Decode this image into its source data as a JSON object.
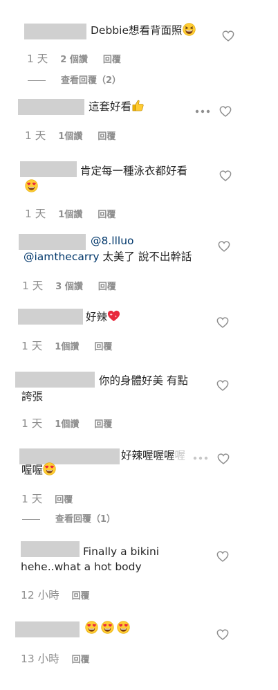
{
  "comments": [
    {
      "text": "Debbie想看背面照",
      "time": "1 天",
      "likes": "2 個讚",
      "reply": "回覆",
      "view_replies": "查看回覆（2）"
    },
    {
      "text": "這套好看",
      "time": "1 天",
      "likes": "1個讚",
      "reply": "回覆"
    },
    {
      "text": "肯定每一種泳衣都好看",
      "time": "1 天",
      "likes": "1個讚",
      "reply": "回覆"
    },
    {
      "mention": "@8.llluo",
      "text_line2_mention": "@iamthecarry",
      "text_line2": " 太美了 說不出幹話",
      "time": "1 天",
      "likes": "3 個讚",
      "reply": "回覆"
    },
    {
      "text": "好辣",
      "time": "1 天",
      "likes": "1個讚",
      "reply": "回覆"
    },
    {
      "text": "你的身體好美 有點",
      "text_line2": "誇張",
      "time": "1 天",
      "likes": "1個讚",
      "reply": "回覆"
    },
    {
      "text": "好辣喔喔喔",
      "text_faded": "喔",
      "text_line2": "喔喔",
      "time": "1 天",
      "reply": "回覆",
      "view_replies": "查看回覆（1）"
    },
    {
      "text": "Finally a bikini",
      "text_line2": "hehe..what a hot body",
      "time": "12 小時",
      "reply": "回覆"
    },
    {
      "time": "13 小時",
      "reply": "回覆"
    }
  ]
}
